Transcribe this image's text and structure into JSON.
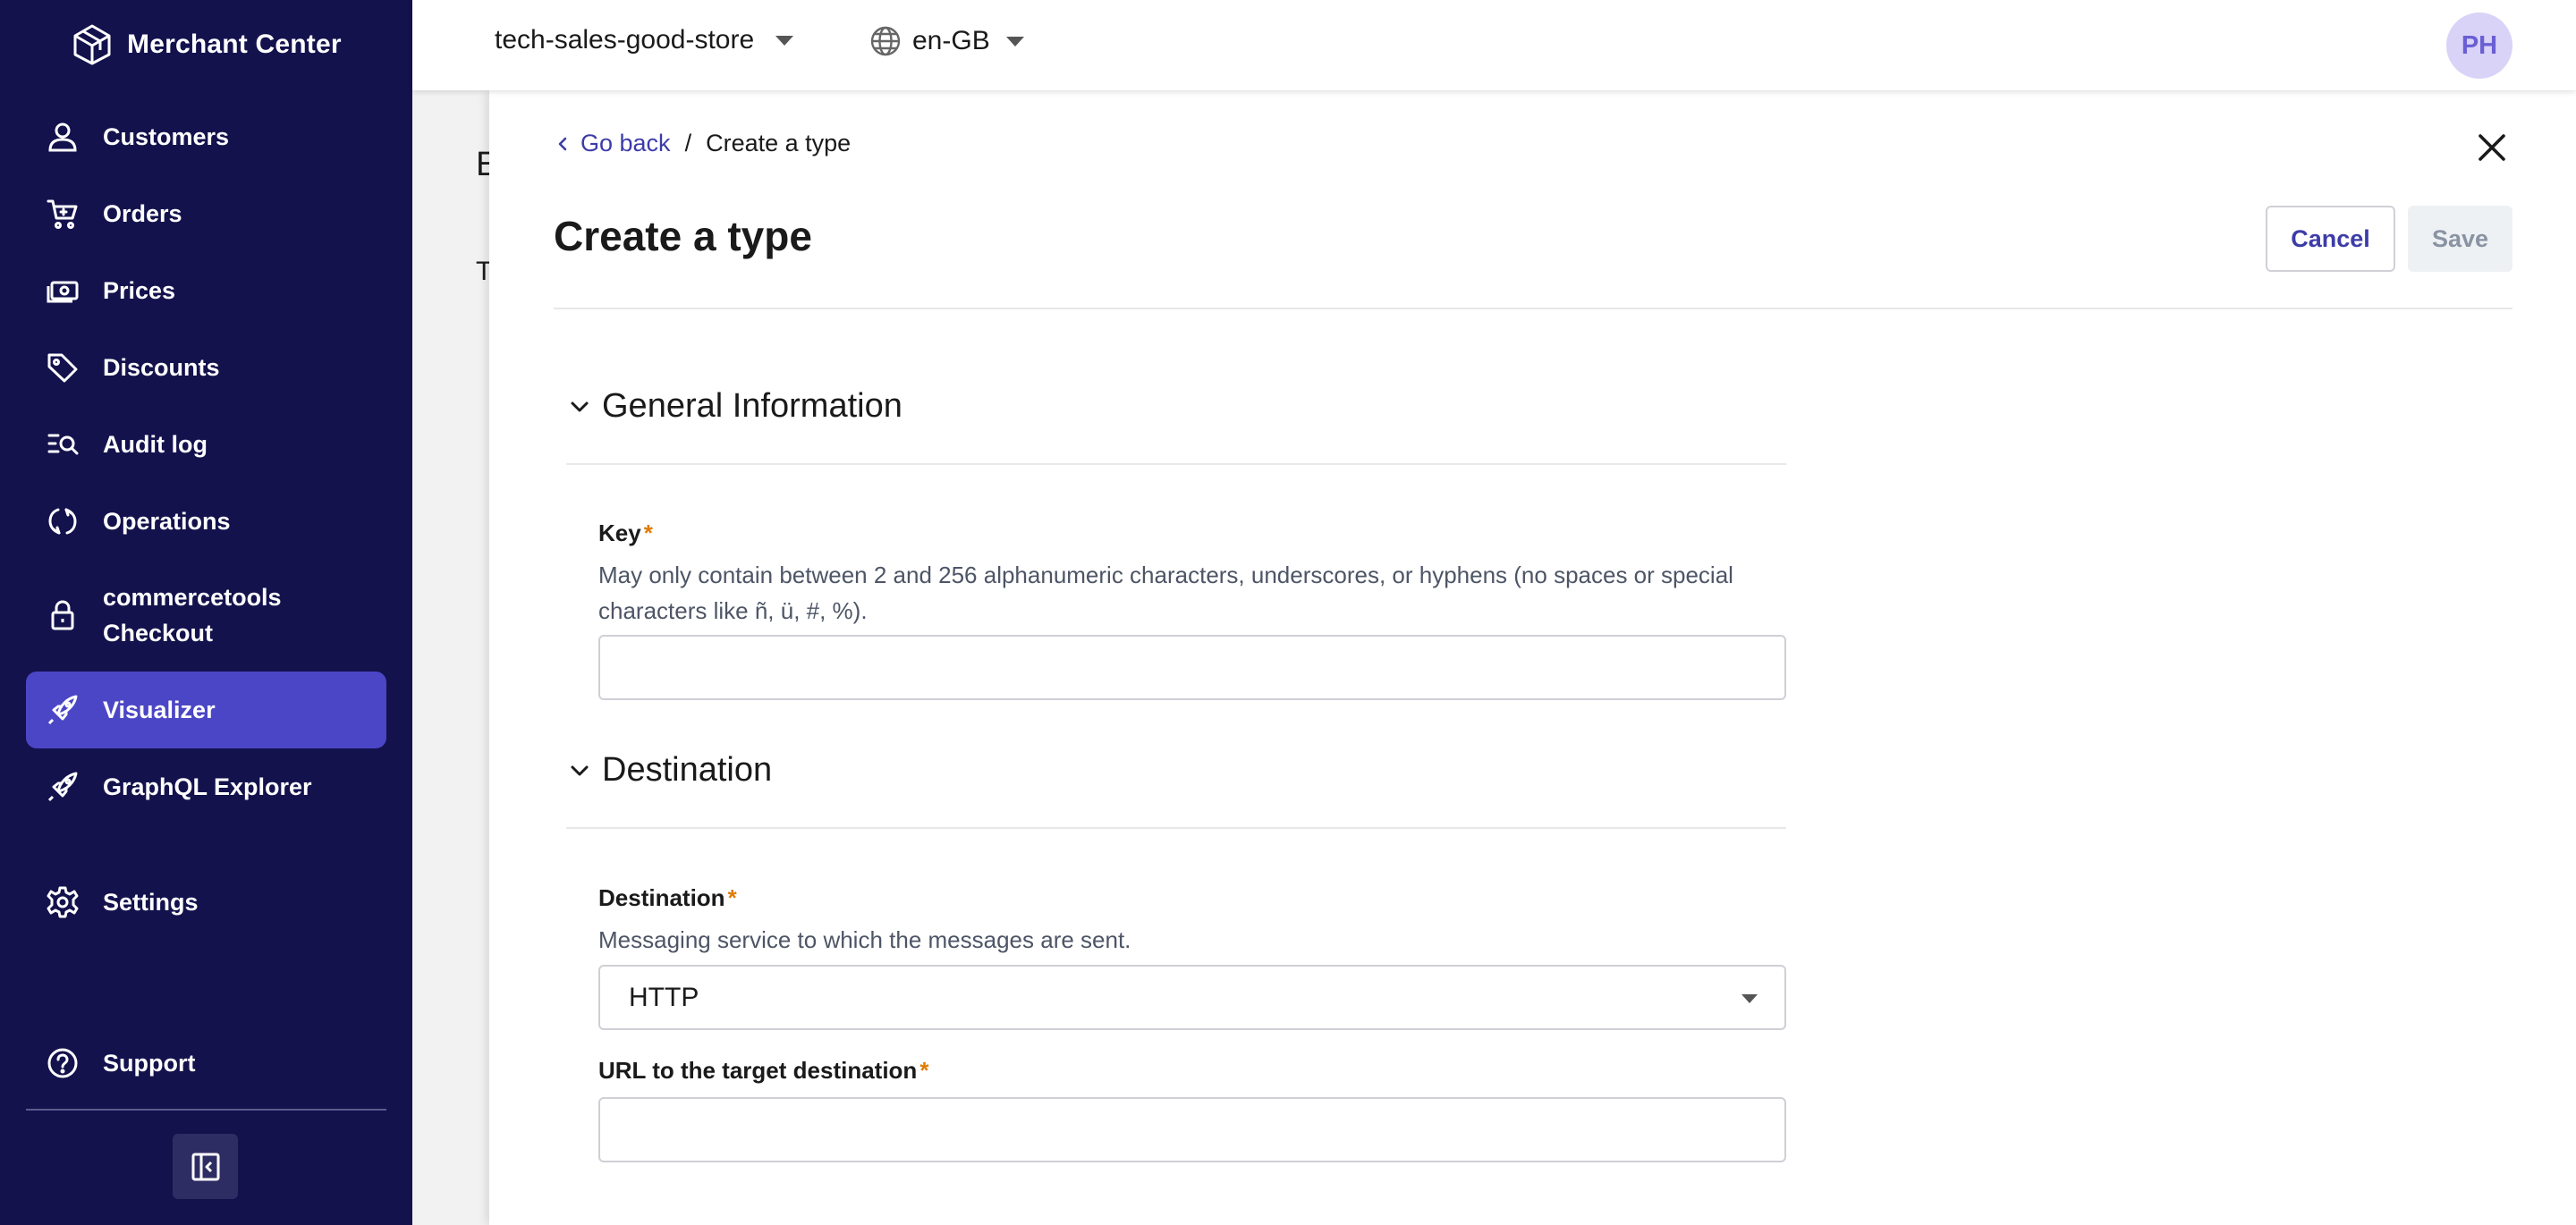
{
  "brand": {
    "name": "Merchant Center"
  },
  "topbar": {
    "project": "tech-sales-good-store",
    "locale": "en-GB",
    "avatar_initials": "PH"
  },
  "sidebar": {
    "items": [
      {
        "label": "Customers",
        "icon": "user-icon"
      },
      {
        "label": "Orders",
        "icon": "cart-icon"
      },
      {
        "label": "Prices",
        "icon": "money-icon"
      },
      {
        "label": "Discounts",
        "icon": "tag-icon"
      },
      {
        "label": "Audit log",
        "icon": "search-list-icon"
      },
      {
        "label": "Operations",
        "icon": "sync-icon"
      },
      {
        "label": "commercetools Checkout",
        "label_line1": "commercetools",
        "label_line2": "Checkout",
        "icon": "lock-icon"
      },
      {
        "label": "Visualizer",
        "icon": "rocket-icon",
        "active": true
      },
      {
        "label": "GraphQL Explorer",
        "icon": "rocket-icon"
      },
      {
        "label": "Settings",
        "icon": "gear-icon"
      },
      {
        "label": "Support",
        "icon": "help-circle-icon"
      }
    ],
    "active_color": "#4b46c5",
    "background_color": "#13124d"
  },
  "background_page": {
    "title_peek": "E",
    "text_peek": "T"
  },
  "panel": {
    "breadcrumb": {
      "back_label": "Go back",
      "separator": "/",
      "current": "Create a type"
    },
    "title": "Create a type",
    "cancel_label": "Cancel",
    "save_label": "Save",
    "sections": {
      "general": {
        "title": "General Information",
        "key_label": "Key",
        "key_required": "*",
        "key_description": "May only contain between 2 and 256 alphanumeric characters, underscores, or hyphens (no spaces or special characters like ñ, ü, #, %).",
        "key_value": ""
      },
      "destination": {
        "title": "Destination",
        "destination_label": "Destination",
        "destination_required": "*",
        "destination_description": "Messaging service to which the messages are sent.",
        "destination_value": "HTTP",
        "url_label": "URL to the target destination",
        "url_required": "*",
        "url_value": ""
      }
    }
  },
  "colors": {
    "link": "#3c3ca8",
    "required": "#e07b00",
    "avatar_bg": "#d8d3f7",
    "avatar_fg": "#6a5fd3"
  }
}
